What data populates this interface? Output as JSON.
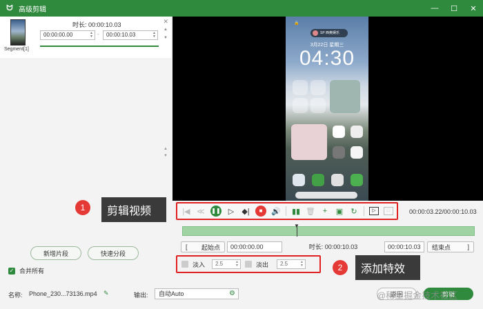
{
  "window": {
    "title": "高级剪辑",
    "app_icon": "bunny-logo-icon",
    "controls": [
      "minimize",
      "maximize",
      "close"
    ]
  },
  "segment": {
    "label": "Segment[1]",
    "duration_text": "时长: 00:00:10.03",
    "start_time": "00:00:00.00",
    "end_time": "00:00:10.03",
    "separator": "-"
  },
  "left_actions": {
    "add_segment": "新增片段",
    "quick_split": "快速分段",
    "merge_all": "合并所有",
    "merge_all_checked": true
  },
  "preview": {
    "phone_date": "3月22日 星期三",
    "phone_time": "04:30",
    "phone_pill_text": "SP 西奥娱乐"
  },
  "playback_toolbar": {
    "icons": [
      "skip-to-start-icon",
      "rewind-icon",
      "pause-icon",
      "step-forward-icon",
      "mark-split-icon",
      "stop-icon",
      "volume-icon",
      "split-clip-icon",
      "delete-icon",
      "add-icon",
      "copy-icon",
      "rotate-icon",
      "crop-icon",
      "fit-frame-icon"
    ],
    "timecode": "00:00:03.22/00:00:10.03"
  },
  "range": {
    "start_label": "起始点",
    "start_time": "00:00:00.00",
    "duration_text": "时长: 00:00:10.03",
    "end_time": "00:00:10.03",
    "end_label": "结束点",
    "left_bracket": "[",
    "right_bracket": "]"
  },
  "effects": {
    "fade_in_label": "淡入",
    "fade_in_value": "2.5",
    "fade_out_label": "淡出",
    "fade_out_value": "2.5"
  },
  "annotations": {
    "callout1_number": "1",
    "callout1_text": "剪辑视频",
    "callout2_number": "2",
    "callout2_text": "添加特效"
  },
  "bottom": {
    "name_label": "名称:",
    "file_name": "Phone_230...73136.mp4",
    "output_label": "输出:",
    "output_value": "自动Auto",
    "back_button": "返回",
    "clip_button": "剪辑"
  },
  "watermark": "@稀土掘金技术社区",
  "colors": {
    "brand_green": "#2f8a3e",
    "highlight_red": "#e02020",
    "timeline_green": "#9fd3a4"
  }
}
